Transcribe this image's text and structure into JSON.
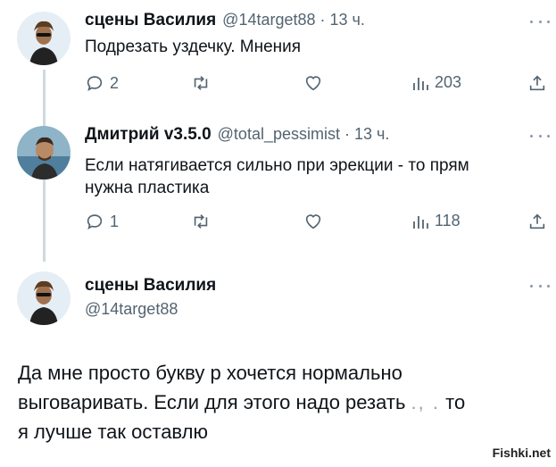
{
  "tweets": [
    {
      "name": "сцены Василия",
      "handle": "@14target88",
      "time": "13 ч.",
      "text": "Подрезать уздечку. Мнения",
      "replies": "2",
      "views": "203"
    },
    {
      "name": "Дмитрий v3.5.0",
      "handle": "@total_pessimist",
      "time": "13 ч.",
      "text_line1": "Если натягивается сильно при эрекции - то прям",
      "text_line2": "нужна пластика",
      "replies": "1",
      "views": "118"
    }
  ],
  "main_tweet": {
    "name": "сцены Василия",
    "handle": "@14target88",
    "line1": "Да мне просто букву р хочется нормально",
    "line2": "выговаривать. Если для этого надо резать ",
    "censored": "., .",
    "line2_end": " то",
    "line3": "я лучше так оставлю"
  },
  "icons": [
    "reply-icon",
    "retweet-icon",
    "like-icon",
    "views-icon",
    "share-icon",
    "more-icon"
  ],
  "colors": {
    "text": "#0f1419",
    "muted": "#536471",
    "thread_line": "#cfd9de"
  },
  "watermark": "Fishki.net"
}
